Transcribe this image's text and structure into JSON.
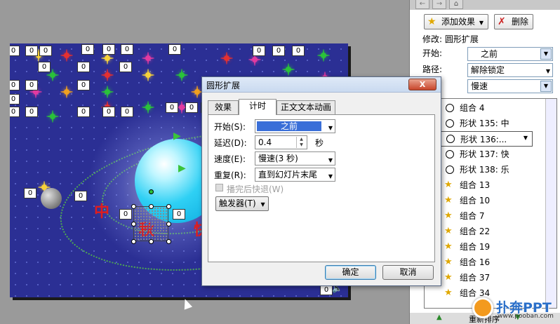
{
  "slide": {
    "zero_label": "0",
    "title_chars": [
      "中",
      "秋",
      "快"
    ],
    "speaker_icon": "speaker-icon"
  },
  "task_pane": {
    "nav_back": "←",
    "nav_forward": "→",
    "nav_home": "home-icon",
    "add_effect_label": "添加效果",
    "remove_label": "删除",
    "modify_label": "修改: 圆形扩展",
    "start_label": "开始:",
    "start_value": "之前",
    "path_label": "路径:",
    "path_value": "解除锁定",
    "speed_value": "慢速",
    "items": [
      {
        "icon": "circle-icon",
        "label": "组合 4"
      },
      {
        "icon": "circle-icon",
        "label": "形状 135: 中"
      },
      {
        "icon": "circle-icon",
        "label": "形状 136:..."
      },
      {
        "icon": "circle-icon",
        "label": "形状 137: 快"
      },
      {
        "icon": "circle-icon",
        "label": "形状 138: 乐"
      },
      {
        "icon": "star-icon",
        "label": "组合 13"
      },
      {
        "icon": "star-icon",
        "label": "组合 10"
      },
      {
        "icon": "star-icon",
        "label": "组合 7"
      },
      {
        "icon": "star-icon",
        "label": "组合 22"
      },
      {
        "icon": "star-icon",
        "label": "组合 19"
      },
      {
        "icon": "star-icon",
        "label": "组合 16"
      },
      {
        "icon": "star-icon",
        "label": "组合 37"
      },
      {
        "icon": "star-icon",
        "label": "组合 34"
      }
    ],
    "bottom_label": "重新排序",
    "watermark_text": "扑奔PPT",
    "watermark_url": "www.pooban.com"
  },
  "dialog": {
    "title": "圆形扩展",
    "close_label": "X",
    "tabs": [
      "效果",
      "计时",
      "正文文本动画"
    ],
    "start_label": "开始(S):",
    "start_value": "之前",
    "delay_label": "延迟(D):",
    "delay_value": "0.4",
    "delay_unit": "秒",
    "speed_label": "速度(E):",
    "speed_value": "慢速(3 秒)",
    "repeat_label": "重复(R):",
    "repeat_value": "直到幻灯片末尾",
    "rewind_label": "播完后快退(W)",
    "trigger_label": "触发器(T)",
    "ok_label": "确定",
    "cancel_label": "取消"
  }
}
